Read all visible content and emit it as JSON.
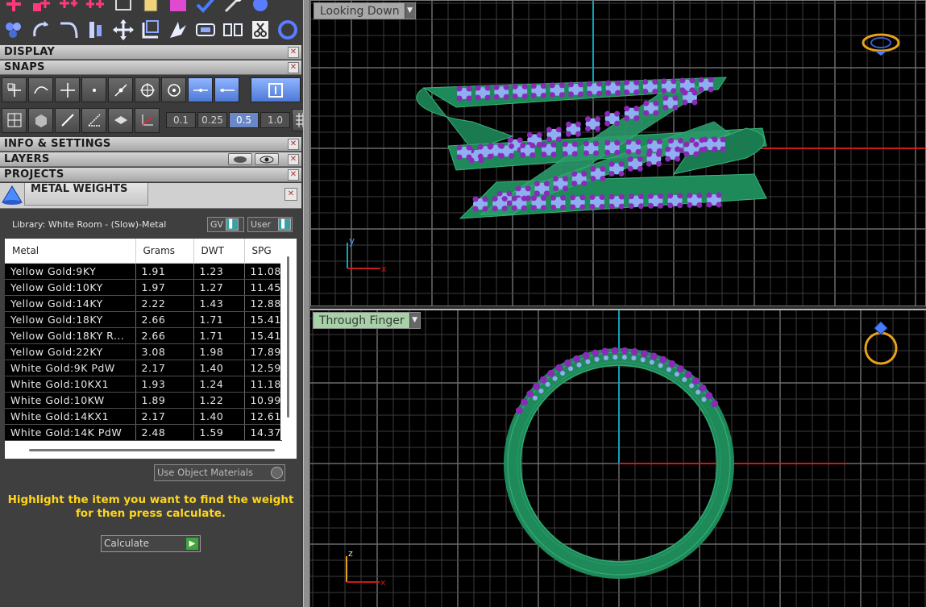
{
  "sections": {
    "display": "DISPLAY",
    "snaps": "SNAPS",
    "info_settings": "INFO & SETTINGS",
    "layers": "LAYERS",
    "projects": "PROJECTS",
    "metal_weights": "METAL WEIGHTS"
  },
  "snap_values": [
    "0.1",
    "0.25",
    "0.5",
    "1.0"
  ],
  "snap_active_value": "0.5",
  "metal_weights": {
    "library_label": "Library: White Room - (Slow)-Metal",
    "toggle_gv": "GV",
    "toggle_user": "User",
    "columns": [
      "Metal",
      "Grams",
      "DWT",
      "SPG"
    ],
    "rows": [
      [
        "Yellow Gold:9KY",
        "1.91",
        "1.23",
        "11.08"
      ],
      [
        "Yellow Gold:10KY",
        "1.97",
        "1.27",
        "11.45"
      ],
      [
        "Yellow Gold:14KY",
        "2.22",
        "1.43",
        "12.88"
      ],
      [
        "Yellow Gold:18KY",
        "2.66",
        "1.71",
        "15.41"
      ],
      [
        "Yellow Gold:18KY R...",
        "2.66",
        "1.71",
        "15.41"
      ],
      [
        "Yellow Gold:22KY",
        "3.08",
        "1.98",
        "17.89"
      ],
      [
        "White Gold:9K PdW",
        "2.17",
        "1.40",
        "12.59"
      ],
      [
        "White Gold:10KX1",
        "1.93",
        "1.24",
        "11.18"
      ],
      [
        "White Gold:10KW",
        "1.89",
        "1.22",
        "10.99"
      ],
      [
        "White Gold:14KX1",
        "2.17",
        "1.40",
        "12.61"
      ],
      [
        "White Gold:14K PdW",
        "2.48",
        "1.59",
        "14.37"
      ]
    ],
    "use_object_materials": "Use Object Materials",
    "hint": "Highlight the item you want to find the weight for then press calculate.",
    "calculate_label": "Calculate"
  },
  "viewports": {
    "top_label": "Looking Down",
    "bottom_label": "Through Finger",
    "top_axis_y": "y",
    "top_axis_x": "x",
    "bottom_axis_z": "z",
    "bottom_axis_x": "x"
  },
  "colors": {
    "grid": "#3c3c3c",
    "ring_green": "#1e8a5a",
    "gem_purple": "#8a2ab8",
    "gem_blue": "#8fb0f0",
    "axis_red": "#c81b1b",
    "axis_cyan": "#0fa3b3",
    "gizmo_orange": "#e8a21a"
  }
}
